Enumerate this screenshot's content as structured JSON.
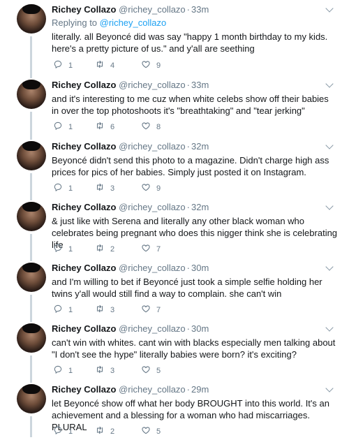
{
  "tweets": [
    {
      "name": "Richey Collazo",
      "handle": "@richey_collazo",
      "time": "33m",
      "reply_prefix": "Replying to ",
      "reply_to": "@richey_collazo",
      "text": "literally. all Beyoncé did was say \"happy 1 month birthday to my kids. here's a pretty picture of us.\" and y'all are seething",
      "replies": "1",
      "retweets": "4",
      "likes": "9"
    },
    {
      "name": "Richey Collazo",
      "handle": "@richey_collazo",
      "time": "33m",
      "text": "and it's interesting to me cuz when white celebs show off their babies in over the top photoshoots it's \"breathtaking\" and \"tear jerking\"",
      "replies": "1",
      "retweets": "6",
      "likes": "8"
    },
    {
      "name": "Richey Collazo",
      "handle": "@richey_collazo",
      "time": "32m",
      "text": "Beyoncé didn't send this photo to a magazine. Didn't charge high ass prices for pics of her babies. Simply just posted it on Instagram.",
      "replies": "1",
      "retweets": "3",
      "likes": "9"
    },
    {
      "name": "Richey Collazo",
      "handle": "@richey_collazo",
      "time": "32m",
      "text": "& just like with Serena and literally any other black woman who celebrates being pregnant who does this nigger think she is celebrating life",
      "replies": "1",
      "retweets": "2",
      "likes": "7"
    },
    {
      "name": "Richey Collazo",
      "handle": "@richey_collazo",
      "time": "30m",
      "text": "and I'm willing to bet if Beyoncé just took a simple selfie holding her twins y'all would still find a way to complain. she can't win",
      "replies": "1",
      "retweets": "3",
      "likes": "7"
    },
    {
      "name": "Richey Collazo",
      "handle": "@richey_collazo",
      "time": "30m",
      "text": "can't win with whites. cant win with blacks especially men talking about \"I don't see the hype\" literally babies were born? it's exciting?",
      "replies": "1",
      "retweets": "3",
      "likes": "5"
    },
    {
      "name": "Richey Collazo",
      "handle": "@richey_collazo",
      "time": "29m",
      "text": "let Beyoncé show off what her body BROUGHT into this world. It's an achievement and a blessing for a woman who had miscarriages. PLURAL",
      "replies": "1",
      "retweets": "2",
      "likes": "5"
    }
  ],
  "icons": {
    "reply": "reply-icon",
    "retweet": "retweet-icon",
    "like": "heart-icon",
    "more": "chevron-down-icon"
  },
  "colors": {
    "name": "#14171a",
    "meta": "#657786",
    "link": "#1da1f2",
    "thread_line": "#ccd6dd"
  }
}
